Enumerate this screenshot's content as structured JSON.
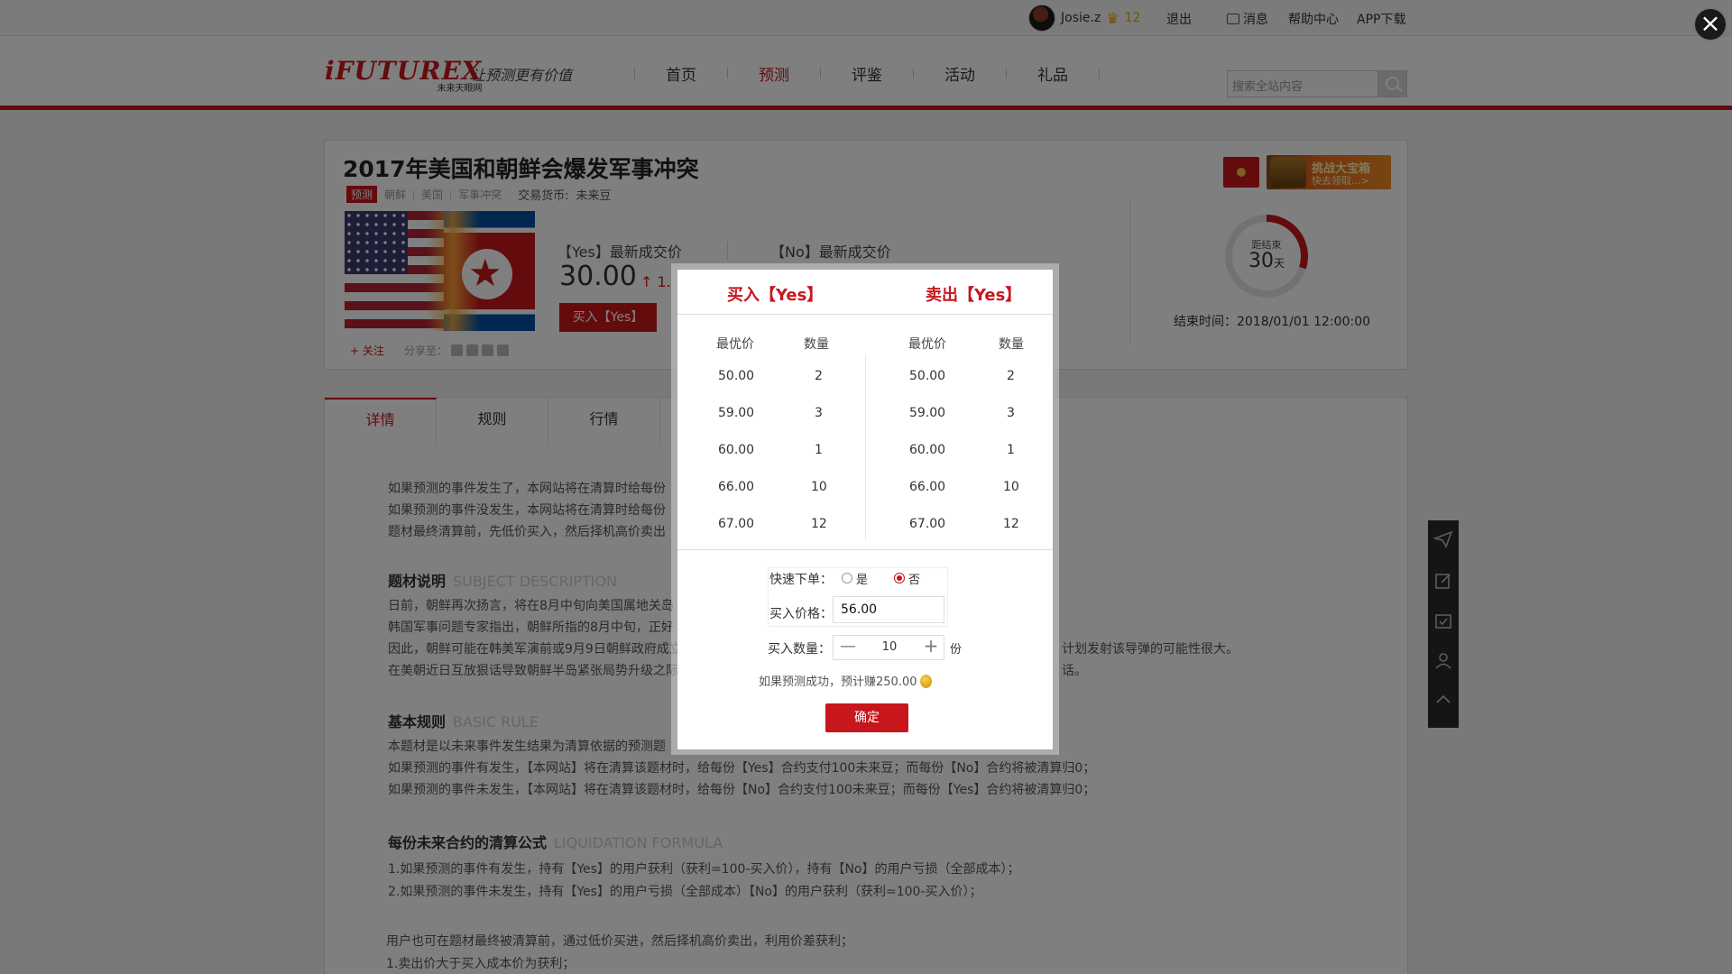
{
  "topbar": {
    "username": "Josie.z",
    "level": "12",
    "logout": "退出",
    "messages": "消息",
    "help": "帮助中心",
    "app": "APP下载"
  },
  "header": {
    "logo_text": "iFUTUREX",
    "logo_sub": "未来天眼网",
    "slogan": "让预测更有价值",
    "nav": [
      "首页",
      "预测",
      "评鉴",
      "活动",
      "礼品"
    ],
    "active_nav": "预测",
    "search_placeholder": "搜索全站内容"
  },
  "product": {
    "title": "2017年美国和朝鲜会爆发军事冲突",
    "category_tag": "预测",
    "tags": [
      "朝鲜",
      "美国",
      "军事冲突"
    ],
    "currency_label": "交易货币:",
    "currency": "未来豆",
    "follow": "关注",
    "share": "分享至：",
    "yes_label": "【Yes】最新成交价",
    "no_label": "【No】最新成交价",
    "yes_price": "30.00",
    "yes_change": "↑ 1.",
    "buy_yes_button": "买入【Yes】",
    "treasure_title": "挑战大宝箱",
    "treasure_sub": "快去领取...>",
    "countdown_label": "距结束",
    "countdown_days": "30",
    "countdown_unit": "天",
    "countdown_fraction": 0.3,
    "end_time": "结束时间：2018/01/01 12:00:00"
  },
  "tabs": [
    "详情",
    "规则",
    "行情"
  ],
  "active_tab": "详情",
  "content": {
    "intro_lines": [
      "如果预测的事件发生了，本网站将在清算时给每份",
      "如果预测的事件没发生，本网站将在清算时给每份",
      "题材最终清算前，先低价买入，然后择机高价卖出"
    ],
    "subject_title": "题材说明",
    "subject_en": "SUBJECT DESCRIPTION",
    "subject_lines": [
      "日前，朝鲜再次扬言，将在8月中旬向美国属地关岛",
      "韩国军事问题专家指出，朝鲜所指的8月中旬，正好",
      "因此，朝鲜可能在韩美军演前或9月9日朝鲜政府成立",
      "在美朝近日互放狠话导致朝鲜半岛紧张局势升级之际"
    ],
    "subject_tail_1": "计划发射该导弹的可能性很大。",
    "subject_tail_2": "话。",
    "rule_title": "基本规则",
    "rule_en": "BASIC RULE",
    "rule_lines": [
      "本题材是以未来事件发生结果为清算依据的预测题",
      "如果预测的事件有发生，【本网站】将在清算该题材时，给每份【Yes】合约支付100未来豆；而每份【No】合约将被清算归0；",
      "如果预测的事件未发生，【本网站】将在清算该题材时，给每份【No】合约支付100未来豆；而每份【Yes】合约将被清算归0；"
    ],
    "formula_title": "每份未来合约的清算公式",
    "formula_en": "LIQUIDATION FORMULA",
    "formula_lines": [
      "1.如果预测的事件有发生，持有【Yes】的用户获利（获利=100-买入价），持有【No】的用户亏损（全部成本）；",
      "2.如果预测的事件未发生，持有【Yes】的用户亏损（全部成本）【No】的用户获利（获利=100-买入价）；"
    ],
    "extra_lines": [
      "用户也可在题材最终被清算前，通过低价买进，然后择机高价卖出，利用价差获利；",
      "1.卖出价大于买入成本价为获利；"
    ]
  },
  "modal": {
    "buy_header": "买入【Yes】",
    "sell_header": "卖出【Yes】",
    "col_best_price": "最优价",
    "col_quantity": "数量",
    "buy_orders": [
      {
        "price": "50.00",
        "qty": "2"
      },
      {
        "price": "59.00",
        "qty": "3"
      },
      {
        "price": "60.00",
        "qty": "1"
      },
      {
        "price": "66.00",
        "qty": "10"
      },
      {
        "price": "67.00",
        "qty": "12"
      }
    ],
    "sell_orders": [
      {
        "price": "50.00",
        "qty": "2"
      },
      {
        "price": "59.00",
        "qty": "3"
      },
      {
        "price": "60.00",
        "qty": "1"
      },
      {
        "price": "66.00",
        "qty": "10"
      },
      {
        "price": "67.00",
        "qty": "12"
      }
    ],
    "quick_order_label": "快速下单：",
    "quick_yes": "是",
    "quick_no": "否",
    "quick_selected": "否",
    "buy_price_label": "买入价格：",
    "buy_price_value": "56.00",
    "buy_qty_label": "买入数量：",
    "qty_minus": "—",
    "qty_value": "10",
    "qty_plus": "+",
    "qty_unit": "份",
    "estimate": "如果预测成功，预计赚250.00",
    "confirm": "确定"
  },
  "colors": {
    "brand_red": "#c8161d",
    "overlay": "rgba(0,0,0,0.5)"
  }
}
